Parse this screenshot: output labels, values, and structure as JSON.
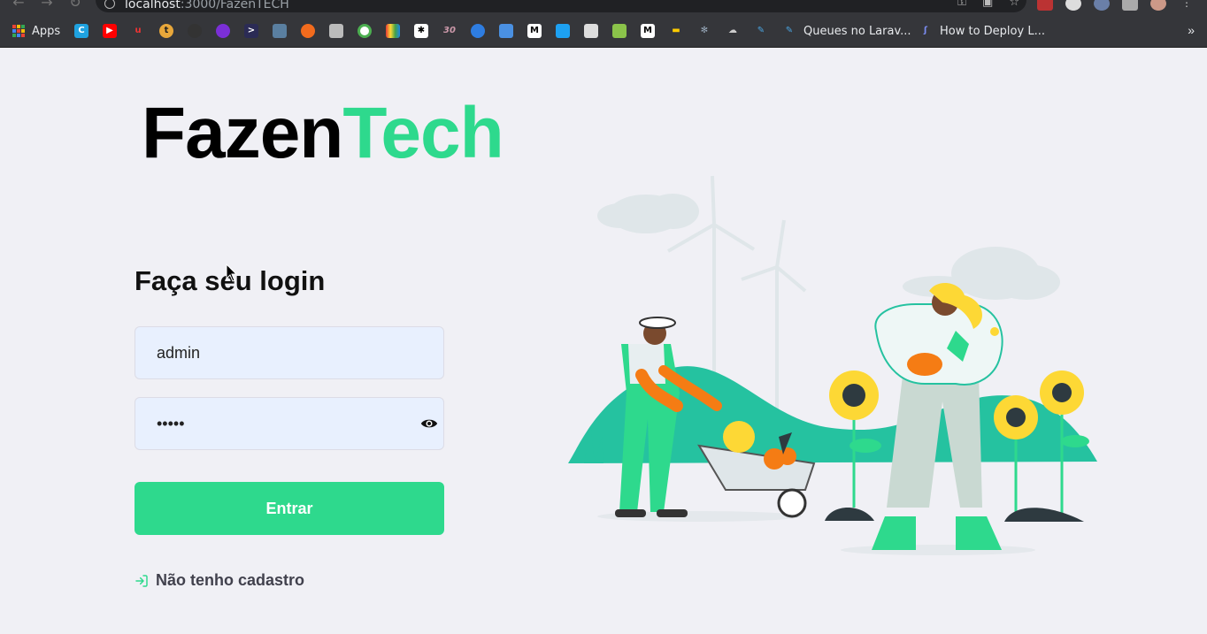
{
  "browser": {
    "url_host": "localhost",
    "url_path": ":3000/FazenTECH",
    "bookmarks": {
      "apps_label": "Apps",
      "queues_label": "Queues no Larav...",
      "deploy_label": "How to Deploy L..."
    }
  },
  "logo": {
    "part1": "Fazen",
    "part2": "Tech"
  },
  "login": {
    "title": "Faça seu login",
    "username_value": "admin",
    "password_value": "•••••",
    "submit_label": "Entrar",
    "register_link": "Não tenho cadastro"
  },
  "colors": {
    "accent": "#2ed98d",
    "background": "#f0f0f5",
    "input_bg": "#e8f0fe",
    "text_dark": "#41414d"
  },
  "icons": {
    "password_toggle": "eye-icon",
    "register": "log-in-icon"
  }
}
